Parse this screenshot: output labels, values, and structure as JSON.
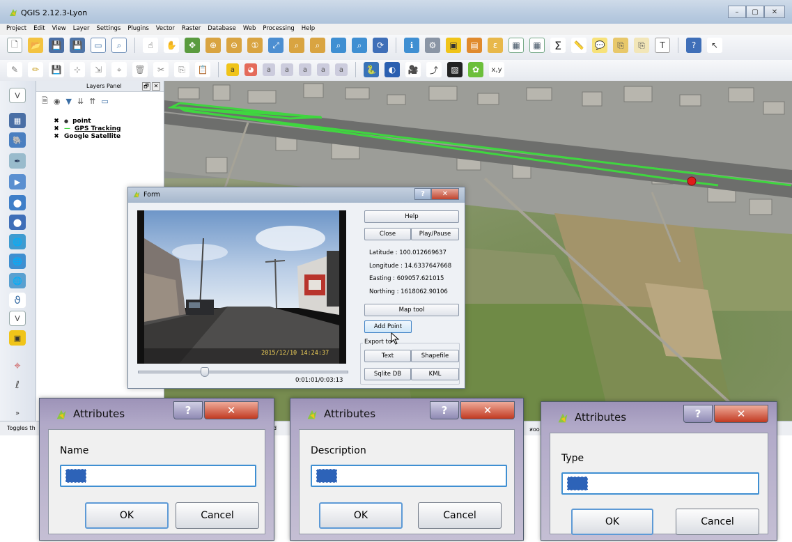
{
  "window": {
    "title": "QGIS 2.12.3-Lyon",
    "minimize": "–",
    "maximize": "▢",
    "close": "✕"
  },
  "menu": [
    "Project",
    "Edit",
    "View",
    "Layer",
    "Settings",
    "Plugins",
    "Vector",
    "Raster",
    "Database",
    "Web",
    "Processing",
    "Help"
  ],
  "layers_panel": {
    "title": "Layers Panel",
    "float_btn": "🗗",
    "close_btn": "✕",
    "layers": [
      {
        "name": "point",
        "checked": "✖",
        "symbol": "●"
      },
      {
        "name": "GPS Tracking",
        "checked": "✖",
        "symbol": "—"
      },
      {
        "name": "Google Satellite",
        "checked": "✖",
        "symbol": ""
      }
    ]
  },
  "status": {
    "left": "Toggles th",
    "mid": "ord",
    "right": "สoo"
  },
  "map": {
    "track_color": "#3fd63f",
    "point_color": "#e01b1b"
  },
  "form": {
    "title": "Form",
    "help_btn": "?",
    "close_btn": "✕",
    "video_timestamp": "2015/12/10  14:24:37",
    "timecode": "0:01:01/0:03:13",
    "buttons": {
      "help": "Help",
      "close": "Close",
      "play_pause": "Play/Pause",
      "map_tool": "Map tool",
      "add_point": "Add Point",
      "text": "Text",
      "shapefile": "Shapefile",
      "sqlite": "Sqlite DB",
      "kml": "KML"
    },
    "latitude": "Latitude : 100.012669637",
    "longitude": "Longitude : 14.6337647668",
    "easting": "Easting : 609057.621015",
    "northing": "Northing : 1618062.90106",
    "export_label": "Export to"
  },
  "attributes": [
    {
      "title": "Attributes",
      "field_label": "Name",
      "ok": "OK",
      "cancel": "Cancel",
      "help": "?",
      "close": "✕"
    },
    {
      "title": "Attributes",
      "field_label": "Description",
      "ok": "OK",
      "cancel": "Cancel",
      "help": "?",
      "close": "✕"
    },
    {
      "title": "Attributes",
      "field_label": "Type",
      "ok": "OK",
      "cancel": "Cancel",
      "help": "?",
      "close": "✕"
    }
  ]
}
